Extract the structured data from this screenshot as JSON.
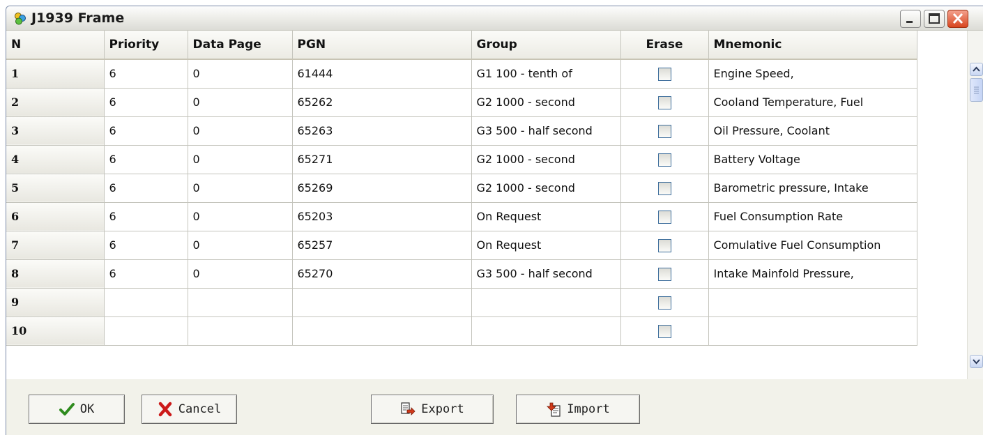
{
  "window": {
    "title": "J1939 Frame",
    "icon": "app-circles-icon"
  },
  "grid": {
    "columns": [
      "N",
      "Priority",
      "Data Page",
      "PGN",
      "Group",
      "Erase",
      "Mnemonic"
    ],
    "rows": [
      {
        "n": "1",
        "priority": "6",
        "data_page": "0",
        "pgn": "61444",
        "group": "G1 100 - tenth of",
        "erase": false,
        "mnemonic": "Engine Speed,"
      },
      {
        "n": "2",
        "priority": "6",
        "data_page": "0",
        "pgn": "65262",
        "group": "G2 1000 - second",
        "erase": false,
        "mnemonic": "Cooland Temperature, Fuel"
      },
      {
        "n": "3",
        "priority": "6",
        "data_page": "0",
        "pgn": "65263",
        "group": "G3 500 - half second",
        "erase": false,
        "mnemonic": "Oil Pressure, Coolant"
      },
      {
        "n": "4",
        "priority": "6",
        "data_page": "0",
        "pgn": "65271",
        "group": "G2 1000 - second",
        "erase": false,
        "mnemonic": "Battery Voltage"
      },
      {
        "n": "5",
        "priority": "6",
        "data_page": "0",
        "pgn": "65269",
        "group": "G2 1000 - second",
        "erase": false,
        "mnemonic": "Barometric pressure, Intake"
      },
      {
        "n": "6",
        "priority": "6",
        "data_page": "0",
        "pgn": "65203",
        "group": "On Request",
        "erase": false,
        "mnemonic": "Fuel Consumption Rate"
      },
      {
        "n": "7",
        "priority": "6",
        "data_page": "0",
        "pgn": "65257",
        "group": "On Request",
        "erase": false,
        "mnemonic": "Comulative Fuel Consumption"
      },
      {
        "n": "8",
        "priority": "6",
        "data_page": "0",
        "pgn": "65270",
        "group": "G3 500 - half second",
        "erase": false,
        "mnemonic": "Intake Mainfold Pressure,"
      },
      {
        "n": "9",
        "priority": "",
        "data_page": "",
        "pgn": "",
        "group": "",
        "erase": false,
        "mnemonic": ""
      },
      {
        "n": "10",
        "priority": "",
        "data_page": "",
        "pgn": "",
        "group": "",
        "erase": false,
        "mnemonic": ""
      }
    ]
  },
  "buttons": {
    "ok": {
      "label": "OK",
      "icon": "checkmark-icon"
    },
    "cancel": {
      "label": "Cancel",
      "icon": "red-x-icon"
    },
    "export": {
      "label": "Export",
      "icon": "export-icon"
    },
    "import": {
      "label": "Import",
      "icon": "import-icon"
    }
  },
  "colors": {
    "accent_check": "#2e8b1e",
    "accent_cancel": "#cc1a1a",
    "close_button": "#d8451e"
  }
}
